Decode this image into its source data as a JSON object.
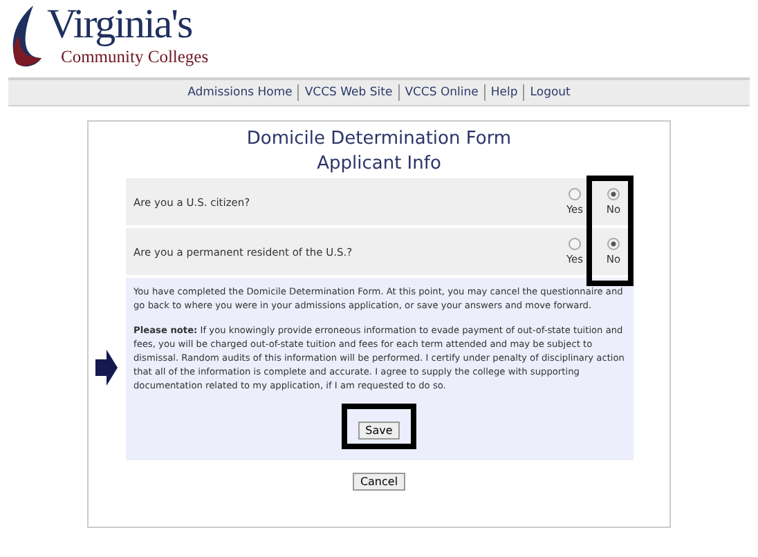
{
  "logo": {
    "title": "Virginia's",
    "subtitle": "Community Colleges"
  },
  "nav": [
    "Admissions Home",
    "VCCS Web Site",
    "VCCS Online",
    "Help",
    "Logout"
  ],
  "form": {
    "title": "Domicile Determination Form",
    "subtitle": "Applicant Info",
    "questions": [
      {
        "text": "Are you a U.S. citizen?",
        "options": [
          {
            "label": "Yes",
            "selected": false
          },
          {
            "label": "No",
            "selected": true
          }
        ]
      },
      {
        "text": "Are you a permanent resident of the U.S.?",
        "options": [
          {
            "label": "Yes",
            "selected": false
          },
          {
            "label": "No",
            "selected": true
          }
        ]
      }
    ],
    "options_column_highlighted": true,
    "intro": "You have completed the Domicile Determination Form. At this point, you may cancel the questionnaire and go back to where you were in your admissions application, or save your answers and move forward.",
    "note": "**Please note:** If you knowingly provide erroneous information to evade payment of out-of-state tuition and fees, you will be charged out-of-state tuition and fees for each term attended and may be subject to dismissal. Random audits of this information will be performed. I certify under penalty of disciplinary action that all of the information is complete and accurate. I agree to supply the college with supporting documentation related to my application, if I am requested to do so.",
    "pointer_arrow": true,
    "save": {
      "label": "Save",
      "highlighted": true
    },
    "cancel": "Cancel"
  }
}
